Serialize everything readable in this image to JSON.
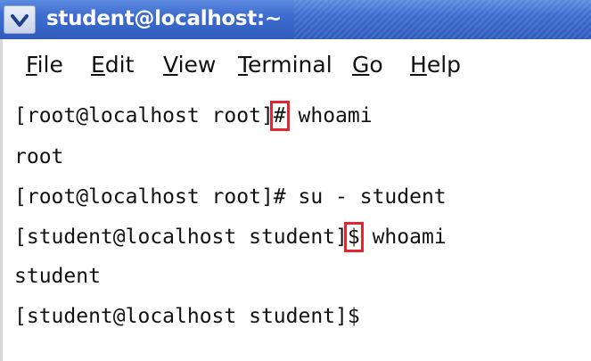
{
  "window": {
    "title": "student@localhost:~"
  },
  "menu": {
    "file": {
      "acc": "F",
      "rest": "ile"
    },
    "edit": {
      "acc": "E",
      "rest": "dit"
    },
    "view": {
      "acc": "V",
      "rest": "iew"
    },
    "terminal": {
      "acc": "T",
      "rest": "erminal"
    },
    "go": {
      "acc": "G",
      "rest": "o"
    },
    "help": {
      "acc": "H",
      "rest": "elp"
    }
  },
  "terminal": {
    "line1": {
      "prompt": "[root@localhost root]",
      "symbol": "#",
      "command": " whoami"
    },
    "line2": "root",
    "line3": "[root@localhost root]# su - student",
    "line4": {
      "prompt": "[student@localhost student]",
      "symbol": "$",
      "command": " whoami"
    },
    "line5": "student",
    "line6": "[student@localhost student]$"
  },
  "colors": {
    "titlebar": "#3e6ccf",
    "highlight": "#e0262e"
  }
}
